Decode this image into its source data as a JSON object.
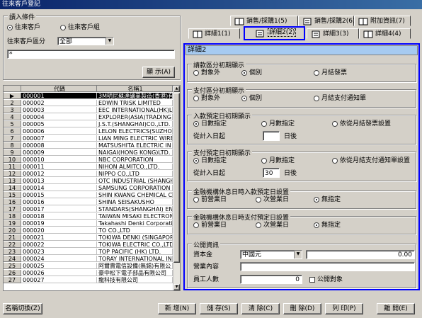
{
  "window": {
    "title": "往來客戶登記"
  },
  "filter": {
    "group_title": "讀入條件",
    "radio_customer": "往來客戶",
    "radio_customer_group": "往來客戶組",
    "category_label": "往來客戶區分",
    "category_value": "全部",
    "search_value": "*",
    "show_button": "顯 示(A)"
  },
  "grid": {
    "headers": {
      "code": "代碼",
      "name": "名稱1"
    },
    "rows": [
      {
        "n": "",
        "code": "000001",
        "name": "3M明尼蘇達礦業製造(香港)有"
      },
      {
        "n": "2",
        "code": "000002",
        "name": "EDWIN TRISK LIMITED"
      },
      {
        "n": "3",
        "code": "000003",
        "name": "EEC INTERNATIONAL(HK)L"
      },
      {
        "n": "4",
        "code": "000004",
        "name": "EXPLORER(ASIA)TRADING C"
      },
      {
        "n": "5",
        "code": "000005",
        "name": "J.S.T.(SHANGHAI)CO.,LTD."
      },
      {
        "n": "6",
        "code": "000006",
        "name": "LELON ELECTRICS(SUZHOU"
      },
      {
        "n": "7",
        "code": "000007",
        "name": "LIAN MING ELECTRIC WIRE"
      },
      {
        "n": "8",
        "code": "000008",
        "name": "MATSUSHITA ELECTRIC IN"
      },
      {
        "n": "9",
        "code": "000009",
        "name": "NAIGAI(HONG KONG)LTD."
      },
      {
        "n": "10",
        "code": "000010",
        "name": "NBC CORPORATION"
      },
      {
        "n": "11",
        "code": "000011",
        "name": "NIHON ALMITCO.,LTD."
      },
      {
        "n": "12",
        "code": "000012",
        "name": "NIPPO CO.,LTD"
      },
      {
        "n": "13",
        "code": "000013",
        "name": "OTC INDUSTRIAL (SHANGH"
      },
      {
        "n": "14",
        "code": "000014",
        "name": "SAMSUNG CORPORATION"
      },
      {
        "n": "15",
        "code": "000015",
        "name": "SHIN KWANG CHEMICAL CO"
      },
      {
        "n": "16",
        "code": "000016",
        "name": "SHINA SEISAKUSHO"
      },
      {
        "n": "17",
        "code": "000017",
        "name": "STANDARS(SHANGHAI) ENT"
      },
      {
        "n": "18",
        "code": "000018",
        "name": "TAIWAN MISAKI ELECTRON"
      },
      {
        "n": "19",
        "code": "000019",
        "name": "Takahashi Denki Corporation"
      },
      {
        "n": "20",
        "code": "000020",
        "name": "TO CO.,LTD"
      },
      {
        "n": "21",
        "code": "000021",
        "name": "TOKIWA DENKI (SINGAPOR"
      },
      {
        "n": "22",
        "code": "000022",
        "name": "TOKIWA ELECTRIC CO.,LTD"
      },
      {
        "n": "23",
        "code": "000023",
        "name": "TOP PACIFIC (HK) LTD."
      },
      {
        "n": "24",
        "code": "000024",
        "name": "TORAY INTERNATIONAL IN"
      },
      {
        "n": "25",
        "code": "000025",
        "name": "阿爾賣電信設備(無錫)有限公"
      },
      {
        "n": "26",
        "code": "000026",
        "name": "豪中松下電子部品有限公司"
      },
      {
        "n": "27",
        "code": "000027",
        "name": "龍科技有限公司"
      }
    ]
  },
  "tabs": {
    "row1": [
      "銷售/採購1(5)",
      "銷售/採購2(6)",
      "附加資訊(7)"
    ],
    "row2": [
      "詳細1(1)",
      "詳細2(2)",
      "詳細3(3)",
      "詳細4(4)"
    ]
  },
  "detail": {
    "title": "詳細2",
    "g1": {
      "title": "請款區分初期顯示",
      "opts": [
        "對象外",
        "個別",
        "月結發票"
      ]
    },
    "g2": {
      "title": "支付區分初期顯示",
      "opts": [
        "對象外",
        "個別",
        "月結支付通知單"
      ]
    },
    "g3": {
      "title": "入款預定日初期顯示",
      "opts": [
        "日數指定",
        "月數指定",
        "依從月結發票設置"
      ],
      "from_label": "從計入日起",
      "days_value": "",
      "days_unit": "日後"
    },
    "g4": {
      "title": "支付預定日初期顯示",
      "opts": [
        "日數指定",
        "月數指定",
        "依從月結支付通知單設置"
      ],
      "from_label": "從計入日起",
      "days_value": "30",
      "days_unit": "日後"
    },
    "g5": {
      "title": "金融機構休息日時入款預定日設置",
      "opts": [
        "前營業日",
        "次營業日",
        "無指定"
      ]
    },
    "g6": {
      "title": "金融機構休息日時支付預定日設置",
      "opts": [
        "前營業日",
        "次營業日",
        "無指定"
      ]
    },
    "g7": {
      "title": "公開資訊",
      "capital_label": "資本金",
      "currency": "中國元",
      "capital_value": "0.00",
      "business_label": "營業內容",
      "business_value": "",
      "staff_label": "員工人數",
      "staff_value": "0",
      "public_label": "公開對象"
    }
  },
  "footer": {
    "switch_name": "名稱切換(Z)",
    "new": "新 增(N)",
    "save": "儲 存(S)",
    "clear": "清 除(C)",
    "delete": "刪 除(D)",
    "print": "列 印(P)",
    "close": "離 開(E)"
  }
}
